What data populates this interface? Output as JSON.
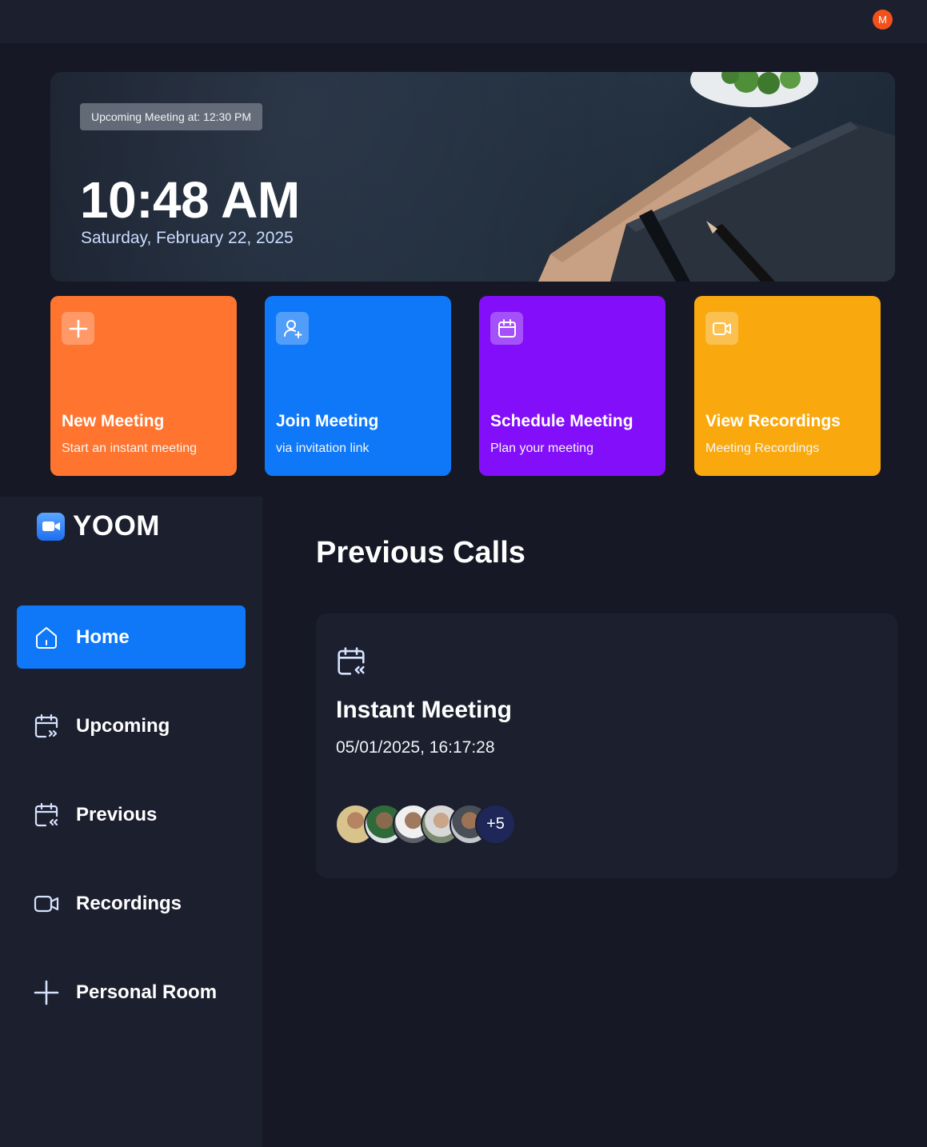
{
  "user": {
    "initial": "M",
    "color": "#f2511b"
  },
  "hero": {
    "badge": "Upcoming Meeting at: 12:30 PM",
    "time": "10:48 AM",
    "date": "Saturday, February 22, 2025"
  },
  "cards": [
    {
      "title": "New Meeting",
      "subtitle": "Start an instant meeting",
      "icon": "plus-icon",
      "color": "#ff742e"
    },
    {
      "title": "Join Meeting",
      "subtitle": "via invitation link",
      "icon": "user-add-icon",
      "color": "#0e78f9"
    },
    {
      "title": "Schedule Meeting",
      "subtitle": "Plan your meeting",
      "icon": "calendar-icon",
      "color": "#830ef9"
    },
    {
      "title": "View Recordings",
      "subtitle": "Meeting Recordings",
      "icon": "video-icon",
      "color": "#f9a90e"
    }
  ],
  "brand": {
    "name": "YOOM"
  },
  "sidebar": {
    "items": [
      {
        "label": "Home",
        "icon": "home-icon",
        "active": true
      },
      {
        "label": "Upcoming",
        "icon": "calendar-upcoming-icon",
        "active": false
      },
      {
        "label": "Previous",
        "icon": "calendar-previous-icon",
        "active": false
      },
      {
        "label": "Recordings",
        "icon": "video-icon",
        "active": false
      },
      {
        "label": "Personal Room",
        "icon": "plus-icon",
        "active": false
      }
    ]
  },
  "main": {
    "title": "Previous Calls",
    "calls": [
      {
        "title": "Instant Meeting",
        "datetime": "05/01/2025, 16:17:28",
        "icon": "calendar-previous-icon",
        "extra_attendees": "+5"
      }
    ]
  },
  "colors": {
    "accent": "#0e78f9",
    "sidebar_bg": "#1c1f2e",
    "page_bg": "#161925"
  }
}
